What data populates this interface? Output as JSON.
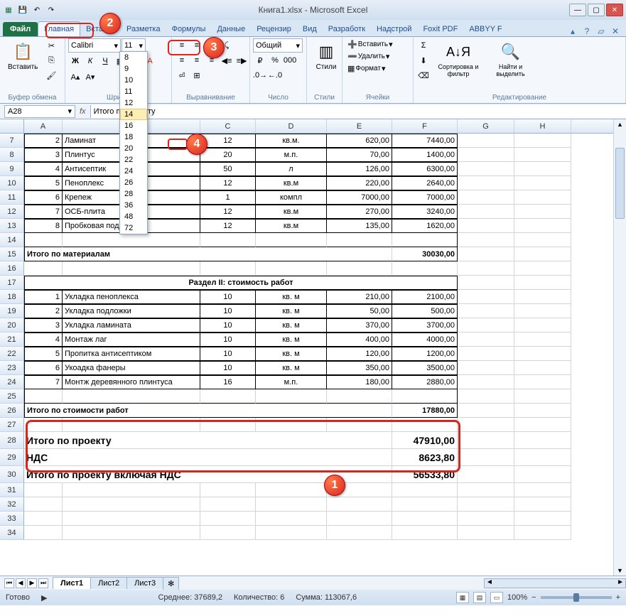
{
  "window": {
    "title": "Книга1.xlsx - Microsoft Excel"
  },
  "tabs": {
    "file": "Файл",
    "home": "Главная",
    "insert": "Вставка",
    "layout": "Разметка",
    "formulas": "Формулы",
    "data": "Данные",
    "review": "Рецензир",
    "view": "Вид",
    "developer": "Разработк",
    "addins": "Надстрой",
    "foxit": "Foxit PDF",
    "abbyy": "ABBYY F"
  },
  "ribbon": {
    "clipboard": {
      "paste": "Вставить",
      "label": "Буфер обмена"
    },
    "font": {
      "name": "Calibri",
      "size": "11",
      "label": "Шрифт",
      "sizes": [
        "8",
        "9",
        "10",
        "11",
        "12",
        "14",
        "16",
        "18",
        "20",
        "22",
        "24",
        "26",
        "28",
        "36",
        "48",
        "72"
      ],
      "selected_size": "14"
    },
    "alignment": {
      "label": "Выравнивание"
    },
    "number": {
      "format": "Общий",
      "label": "Число"
    },
    "styles": {
      "label": "Стили",
      "btn": "Стили"
    },
    "cells": {
      "insert": "Вставить",
      "delete": "Удалить",
      "format": "Формат",
      "label": "Ячейки"
    },
    "editing": {
      "sort": "Сортировка и фильтр",
      "find": "Найти и выделить",
      "label": "Редактирование"
    }
  },
  "namebox": "A28",
  "formula": "Итого по проекту",
  "columns": [
    "A",
    "B",
    "C",
    "D",
    "E",
    "F",
    "G",
    "H"
  ],
  "sheet": {
    "section1_rows": [
      {
        "r": 7,
        "n": "2",
        "name": "Ламинат",
        "qty": "12",
        "unit": "кв.м.",
        "price": "620,00",
        "sum": "7440,00"
      },
      {
        "r": 8,
        "n": "3",
        "name": "Плинтус",
        "qty": "20",
        "unit": "м.п.",
        "price": "70,00",
        "sum": "1400,00"
      },
      {
        "r": 9,
        "n": "4",
        "name": "Антисептик",
        "qty": "50",
        "unit": "л",
        "price": "126,00",
        "sum": "6300,00"
      },
      {
        "r": 10,
        "n": "5",
        "name": "Пеноплекс",
        "qty": "12",
        "unit": "кв.м",
        "price": "220,00",
        "sum": "2640,00"
      },
      {
        "r": 11,
        "n": "6",
        "name": "Крепеж",
        "qty": "1",
        "unit": "компл",
        "price": "7000,00",
        "sum": "7000,00"
      },
      {
        "r": 12,
        "n": "7",
        "name": "ОСБ-плита",
        "qty": "12",
        "unit": "кв.м",
        "price": "270,00",
        "sum": "3240,00"
      },
      {
        "r": 13,
        "n": "8",
        "name": "Пробковая подложка",
        "qty": "12",
        "unit": "кв.м",
        "price": "135,00",
        "sum": "1620,00"
      }
    ],
    "mat_total_label": "Итого по материалам",
    "mat_total": "30030,00",
    "section2_title": "Раздел II: стоимость работ",
    "section2_rows": [
      {
        "r": 18,
        "n": "1",
        "name": "Укладка пеноплекса",
        "qty": "10",
        "unit": "кв. м",
        "price": "210,00",
        "sum": "2100,00"
      },
      {
        "r": 19,
        "n": "2",
        "name": "Укладка подложки",
        "qty": "10",
        "unit": "кв. м",
        "price": "50,00",
        "sum": "500,00"
      },
      {
        "r": 20,
        "n": "3",
        "name": "Укладка  ламината",
        "qty": "10",
        "unit": "кв. м",
        "price": "370,00",
        "sum": "3700,00"
      },
      {
        "r": 21,
        "n": "4",
        "name": "Монтаж лаг",
        "qty": "10",
        "unit": "кв. м",
        "price": "400,00",
        "sum": "4000,00"
      },
      {
        "r": 22,
        "n": "5",
        "name": "Пропитка антисептиком",
        "qty": "10",
        "unit": "кв. м",
        "price": "120,00",
        "sum": "1200,00"
      },
      {
        "r": 23,
        "n": "6",
        "name": "Укоадка фанеры",
        "qty": "10",
        "unit": "кв. м",
        "price": "350,00",
        "sum": "3500,00"
      },
      {
        "r": 24,
        "n": "7",
        "name": "Монтж деревянного плинтуса",
        "qty": "16",
        "unit": "м.п.",
        "price": "180,00",
        "sum": "2880,00"
      }
    ],
    "work_total_label": "Итого по стоимости работ",
    "work_total": "17880,00",
    "proj_total_label": "Итого по проекту",
    "proj_total": "47910,00",
    "vat_label": "НДС",
    "vat": "8623,80",
    "proj_incl_label": "Итого по проекту включая НДС",
    "proj_incl": "56533,80"
  },
  "sheets": {
    "s1": "Лист1",
    "s2": "Лист2",
    "s3": "Лист3"
  },
  "status": {
    "ready": "Готово",
    "avg_label": "Среднее:",
    "avg": "37689,2",
    "count_label": "Количество:",
    "count": "6",
    "sum_label": "Сумма:",
    "sum": "113067,6",
    "zoom": "100%"
  },
  "callouts": {
    "c1": "1",
    "c2": "2",
    "c3": "3",
    "c4": "4"
  }
}
